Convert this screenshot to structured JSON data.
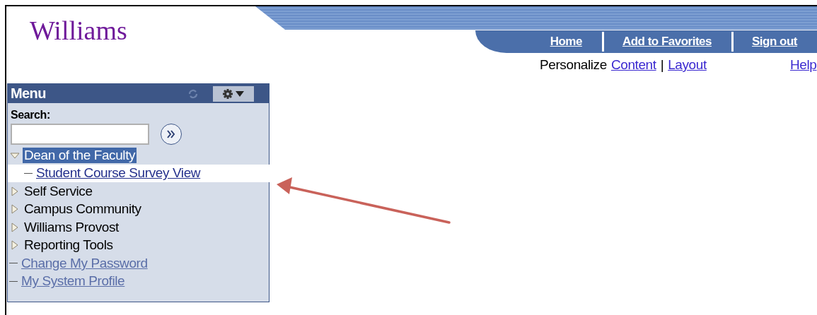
{
  "header": {
    "logo": "Williams",
    "nav_links": [
      "Home",
      "Add to Favorites",
      "Sign out"
    ],
    "personalize": {
      "label": "Personalize",
      "links": [
        "Content",
        "Layout"
      ],
      "separator": "|"
    },
    "help": "Help"
  },
  "menu": {
    "title": "Menu",
    "search_label": "Search:",
    "items": [
      {
        "label": "Dean of the Faculty",
        "kind": "folder",
        "expanded": true,
        "selected": true,
        "highlighted": false,
        "children": [
          {
            "label": "Student Course Survey View",
            "kind": "link",
            "selected": false,
            "highlighted": true
          }
        ]
      },
      {
        "label": "Self Service",
        "kind": "folder",
        "expanded": false,
        "selected": false,
        "highlighted": false
      },
      {
        "label": "Campus Community",
        "kind": "folder",
        "expanded": false,
        "selected": false,
        "highlighted": false
      },
      {
        "label": "Williams Provost",
        "kind": "folder",
        "expanded": false,
        "selected": false,
        "highlighted": false
      },
      {
        "label": "Reporting Tools",
        "kind": "folder",
        "expanded": false,
        "selected": false,
        "highlighted": false
      },
      {
        "label": "Change My Password",
        "kind": "link",
        "selected": false,
        "highlighted": false
      },
      {
        "label": "My System Profile",
        "kind": "link",
        "selected": false,
        "highlighted": false
      }
    ]
  }
}
